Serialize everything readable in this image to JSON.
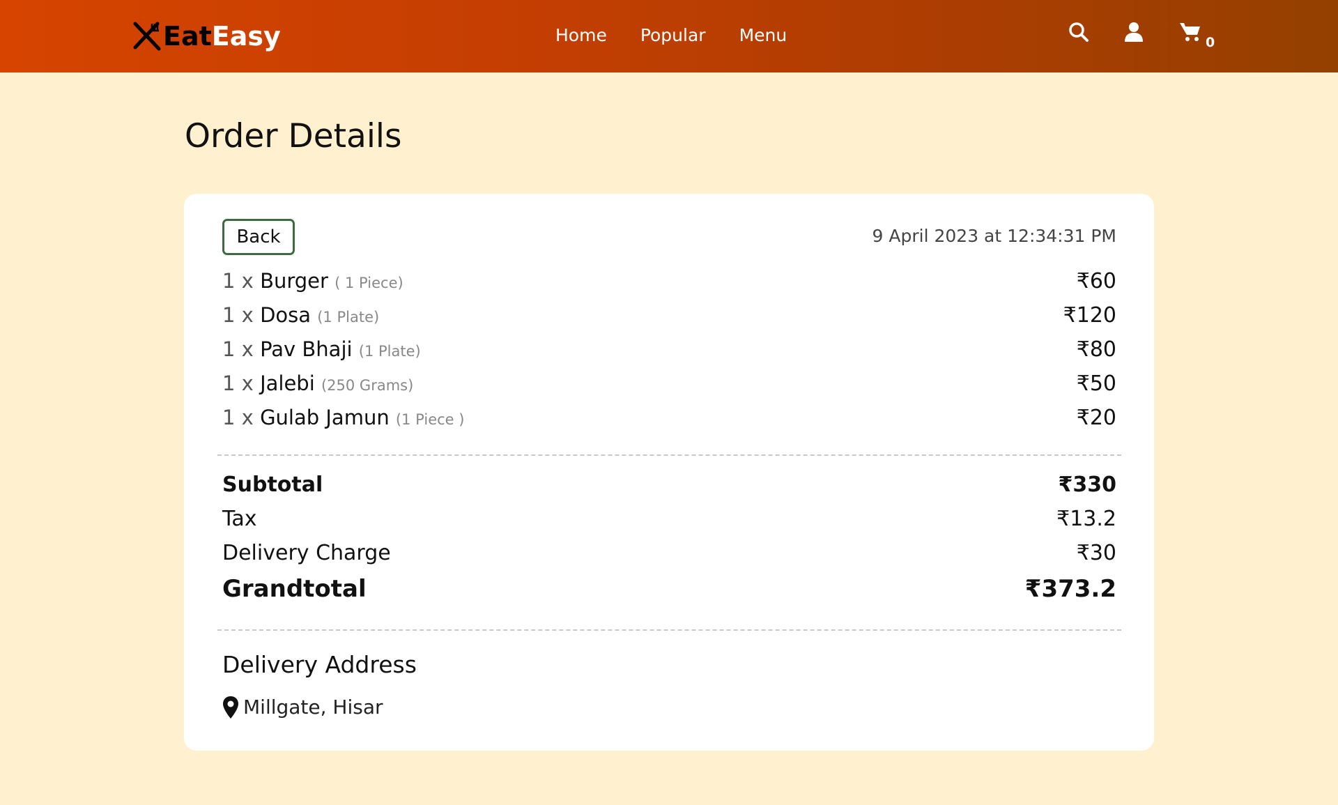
{
  "brand": {
    "eat": "Eat",
    "easy": "Easy",
    "icon": "fork-knife-icon"
  },
  "nav": {
    "links": [
      "Home",
      "Popular",
      "Menu"
    ],
    "cart_count": "0"
  },
  "icons": {
    "search": "search-icon",
    "user": "user-icon",
    "cart": "cart-icon",
    "location": "map-pin-icon"
  },
  "page": {
    "title": "Order Details"
  },
  "order": {
    "back_label": "Back",
    "date": "9 April 2023 at 12:34:31 PM",
    "items": [
      {
        "qty": "1 x",
        "name": "Burger",
        "unit": "( 1 Piece)",
        "price": "₹60"
      },
      {
        "qty": "1 x",
        "name": "Dosa",
        "unit": "(1 Plate)",
        "price": "₹120"
      },
      {
        "qty": "1 x",
        "name": "Pav Bhaji",
        "unit": "(1 Plate)",
        "price": "₹80"
      },
      {
        "qty": "1 x",
        "name": "Jalebi",
        "unit": "(250 Grams)",
        "price": "₹50"
      },
      {
        "qty": "1 x",
        "name": "Gulab Jamun",
        "unit": "(1 Piece )",
        "price": "₹20"
      }
    ],
    "totals": {
      "subtotal_label": "Subtotal",
      "subtotal": "₹330",
      "tax_label": "Tax",
      "tax": "₹13.2",
      "delivery_label": "Delivery Charge",
      "delivery": "₹30",
      "grand_label": "Grandtotal",
      "grand": "₹373.2"
    },
    "address_heading": "Delivery Address",
    "address": "Millgate, Hisar"
  },
  "colors": {
    "nav_start": "#d64400",
    "nav_end": "#944000",
    "background": "#fff0d0",
    "back_border": "#3d6b3f"
  }
}
